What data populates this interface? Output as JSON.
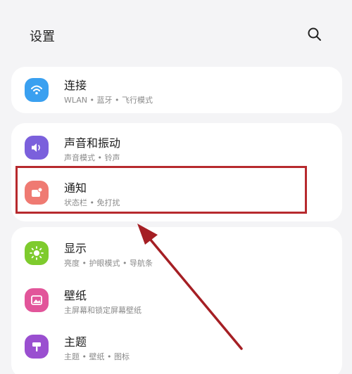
{
  "header": {
    "title": "设置",
    "search_icon": "search-icon"
  },
  "items": [
    {
      "label": "连接",
      "subtitle": "WLAN • 蓝牙 • 飞行模式",
      "icon": "wifi-icon",
      "color": "#3aa0f0"
    },
    {
      "label": "声音和振动",
      "subtitle": "声音模式 • 铃声",
      "icon": "speaker-icon",
      "color": "#7b60dc"
    },
    {
      "label": "通知",
      "subtitle": "状态栏 • 免打扰",
      "icon": "notification-icon",
      "color": "#ef7a72"
    },
    {
      "label": "显示",
      "subtitle": "亮度 • 护眼模式 • 导航条",
      "icon": "brightness-icon",
      "color": "#7ecb2d"
    },
    {
      "label": "壁纸",
      "subtitle": "主屏幕和锁定屏幕壁纸",
      "icon": "wallpaper-icon",
      "color": "#e2559a"
    },
    {
      "label": "主题",
      "subtitle": "主题 • 壁纸 • 图标",
      "icon": "theme-icon",
      "color": "#9a4fd0"
    }
  ],
  "annotation": {
    "highlight_color": "#b72a2e",
    "arrow_color": "#a51f24"
  }
}
